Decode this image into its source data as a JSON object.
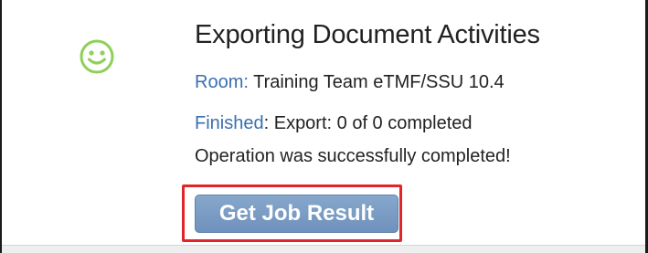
{
  "status": {
    "icon": "smiley-face-icon",
    "icon_color": "#8fcf5a",
    "title": "Exporting Document Activities"
  },
  "room": {
    "label": "Room:",
    "value": " Training Team eTMF/SSU 10.4"
  },
  "finished": {
    "label": "Finished",
    "value": ": Export: 0 of 0 completed"
  },
  "message": "Operation was successfully completed!",
  "action": {
    "button_label": "Get Job Result",
    "highlight_color": "#e0262a",
    "button_color": "#7b9cc4"
  },
  "colors": {
    "link": "#3a6fb0",
    "text": "#222222"
  }
}
